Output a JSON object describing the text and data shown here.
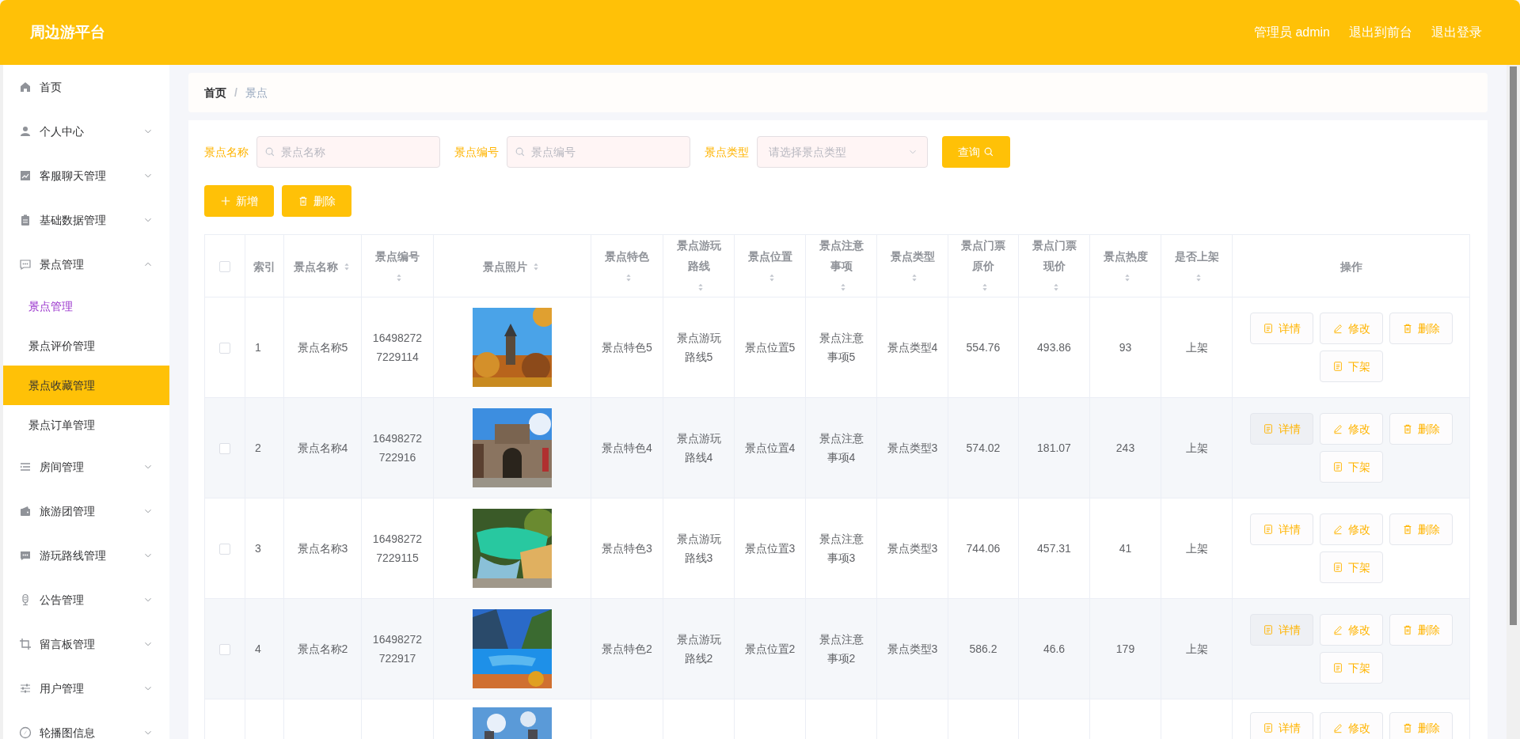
{
  "header": {
    "title": "周边游平台",
    "user": "管理员 admin",
    "links": [
      "退出到前台",
      "退出登录"
    ]
  },
  "sidebar": {
    "items": [
      {
        "kind": "link",
        "label": "首页"
      },
      {
        "kind": "menu",
        "label": "个人中心",
        "expanded": false
      },
      {
        "kind": "menu",
        "label": "客服聊天管理",
        "expanded": false
      },
      {
        "kind": "menu",
        "label": "基础数据管理",
        "expanded": false
      },
      {
        "kind": "menu",
        "label": "景点管理",
        "expanded": true,
        "children": [
          {
            "label": "景点管理",
            "selected": true,
            "hovered": false
          },
          {
            "label": "景点评价管理",
            "selected": false,
            "hovered": false
          },
          {
            "label": "景点收藏管理",
            "selected": false,
            "hovered": true
          },
          {
            "label": "景点订单管理",
            "selected": false,
            "hovered": false
          }
        ]
      },
      {
        "kind": "menu",
        "label": "房间管理",
        "expanded": false
      },
      {
        "kind": "menu",
        "label": "旅游团管理",
        "expanded": false
      },
      {
        "kind": "menu",
        "label": "游玩路线管理",
        "expanded": false
      },
      {
        "kind": "menu",
        "label": "公告管理",
        "expanded": false
      },
      {
        "kind": "menu",
        "label": "留言板管理",
        "expanded": false
      },
      {
        "kind": "menu",
        "label": "用户管理",
        "expanded": false
      },
      {
        "kind": "menu",
        "label": "轮播图信息",
        "expanded": false
      }
    ]
  },
  "breadcrumb": {
    "separator": "/",
    "items": [
      "首页",
      "景点"
    ]
  },
  "search": {
    "fields": [
      {
        "kind": "text",
        "label": "景点名称",
        "placeholder": "景点名称"
      },
      {
        "kind": "text",
        "label": "景点编号",
        "placeholder": "景点编号"
      },
      {
        "kind": "select",
        "label": "景点类型",
        "placeholder": "请选择景点类型"
      }
    ],
    "button": "查询"
  },
  "actions": [
    {
      "kind": "add",
      "label": "新增"
    },
    {
      "kind": "delete",
      "label": "删除"
    }
  ],
  "table": {
    "select_all_checked": false,
    "columns": [
      {
        "label": "索引",
        "sortable": false
      },
      {
        "label": "景点名称",
        "sortable": true
      },
      {
        "label": "景点编号",
        "sortable": true
      },
      {
        "label": "景点照片",
        "sortable": true
      },
      {
        "label": "景点特色",
        "sortable": true
      },
      {
        "label": "景点游玩路线",
        "sortable": true
      },
      {
        "label": "景点位置",
        "sortable": true
      },
      {
        "label": "景点注意事项",
        "sortable": true
      },
      {
        "label": "景点类型",
        "sortable": true
      },
      {
        "label": "景点门票原价",
        "sortable": true
      },
      {
        "label": "景点门票现价",
        "sortable": true
      },
      {
        "label": "景点热度",
        "sortable": true
      },
      {
        "label": "是否上架",
        "sortable": true
      },
      {
        "label": "操作",
        "sortable": false
      }
    ],
    "rows": [
      {
        "kind": "full",
        "checked": false,
        "cells": [
          "1",
          "景点名称5",
          "164982727229114",
          null,
          "景点特色5",
          "景点游玩路线5",
          "景点位置5",
          "景点注意事项5",
          "景点类型4",
          "554.76",
          "493.86",
          "93",
          "上架"
        ],
        "actions": [
          "详情",
          "修改",
          "删除",
          "下架"
        ]
      },
      {
        "kind": "full",
        "checked": false,
        "cells": [
          "2",
          "景点名称4",
          "16498272722916",
          null,
          "景点特色4",
          "景点游玩路线4",
          "景点位置4",
          "景点注意事项4",
          "景点类型3",
          "574.02",
          "181.07",
          "243",
          "上架"
        ],
        "actions": [
          "详情",
          "修改",
          "删除",
          "下架"
        ]
      },
      {
        "kind": "full",
        "checked": false,
        "cells": [
          "3",
          "景点名称3",
          "164982727229115",
          null,
          "景点特色3",
          "景点游玩路线3",
          "景点位置3",
          "景点注意事项3",
          "景点类型3",
          "744.06",
          "457.31",
          "41",
          "上架"
        ],
        "actions": [
          "详情",
          "修改",
          "删除",
          "下架"
        ]
      },
      {
        "kind": "full",
        "checked": false,
        "cells": [
          "4",
          "景点名称2",
          "16498272722917",
          null,
          "景点特色2",
          "景点游玩路线2",
          "景点位置2",
          "景点注意事项2",
          "景点类型3",
          "586.2",
          "46.6",
          "179",
          "上架"
        ],
        "actions": [
          "详情",
          "修改",
          "删除",
          "下架"
        ]
      },
      {
        "kind": "partial",
        "actions": [
          "详情",
          "修改",
          "删除"
        ]
      }
    ]
  }
}
